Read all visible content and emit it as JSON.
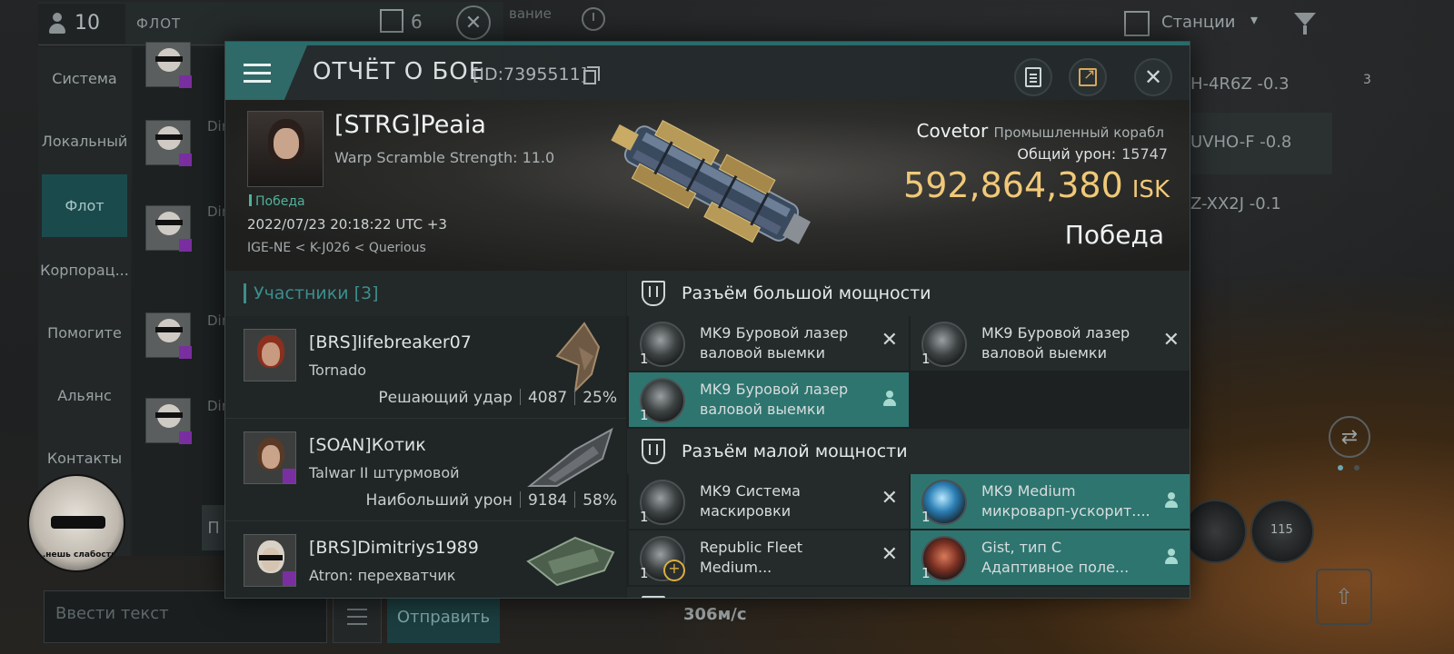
{
  "background_ui": {
    "chat": {
      "member_count": "10",
      "title": "ФЛОТ",
      "doc_count": "6",
      "tabs": [
        "Система",
        "Локальный",
        "Флот",
        "Корпорац...",
        "Помогите",
        "Альянс",
        "Контакты"
      ],
      "active_tab": "Флот",
      "message_names": [
        "Dim",
        "Dim",
        "Dim",
        "Dim",
        "Dim"
      ],
      "input_placeholder": "Ввести текст",
      "send_label": "Отправить",
      "profile_caption": "...нешь слабость",
      "side_button": "П"
    },
    "top_fragment": "вание",
    "stations_label": "Станции",
    "systems": [
      "H-4R6Z -0.3",
      "UVHO-F -0.8",
      "Z-XX2J -0.1"
    ],
    "system_count": "3",
    "module_count": "115",
    "speed": "306м/с"
  },
  "report": {
    "title": "ОТЧЁТ О БОЕ",
    "id": "[ID:7395511]",
    "victim": {
      "name": "[STRG]Peaia",
      "subtitle": "Warp Scramble Strength: 11.0",
      "result_tag": "Победа",
      "datetime": "2022/07/23 20:18:22 UTC +3",
      "location": "IGE-NE < K-J026 < Querious",
      "ship_name": "Covetor",
      "ship_class": "Промышленный корабл",
      "damage_label": "Общий урон:",
      "damage_value": "15747",
      "isk_value": "592,864,380",
      "isk_unit": "ISK",
      "result": "Победа"
    },
    "participants": {
      "header": "Участники [3]",
      "rows": [
        {
          "name": "[BRS]lifebreaker07",
          "ship": "Tornado",
          "role": "Решающий удар",
          "damage": "4087",
          "percent": "25%"
        },
        {
          "name": "[SOAN]Котик",
          "ship": "Talwar II штурмовой",
          "role": "Наибольший урон",
          "damage": "9184",
          "percent": "58%"
        },
        {
          "name": "[BRS]Dimitriys1989",
          "ship": "Atron: перехватчик",
          "role": "",
          "damage": "",
          "percent": ""
        }
      ]
    },
    "fittings": {
      "high_slot_header": "Разъём большой мощности",
      "high_slots": [
        {
          "qty": "1",
          "line1": "MK9 Буровой лазер",
          "line2": "валовой выемки",
          "state": "destroyed"
        },
        {
          "qty": "1",
          "line1": "MK9 Буровой лазер",
          "line2": "валовой выемки",
          "state": "destroyed"
        },
        {
          "qty": "1",
          "line1": "MK9 Буровой лазер",
          "line2": "валовой выемки",
          "state": "dropped"
        }
      ],
      "low_slot_header": "Разъём малой мощности",
      "low_slots": [
        {
          "qty": "1",
          "line1": "MK9 Система",
          "line2": "маскировки",
          "state": "destroyed"
        },
        {
          "qty": "1",
          "line1": "MK9 Medium",
          "line2": "микроварп-ускорит....",
          "state": "dropped"
        },
        {
          "qty": "1",
          "line1": "Republic Fleet",
          "line2": "Medium...",
          "state": "destroyed"
        },
        {
          "qty": "1",
          "line1": "Gist, тип C",
          "line2": "Адаптивное поле...",
          "state": "dropped"
        }
      ],
      "next_header_fragment": "Р"
    }
  },
  "colors": {
    "accent": "#2f6a68",
    "highlight_row": "#2e7570",
    "isk_gold": "#f0c978",
    "victory_green": "#4fb39b"
  }
}
